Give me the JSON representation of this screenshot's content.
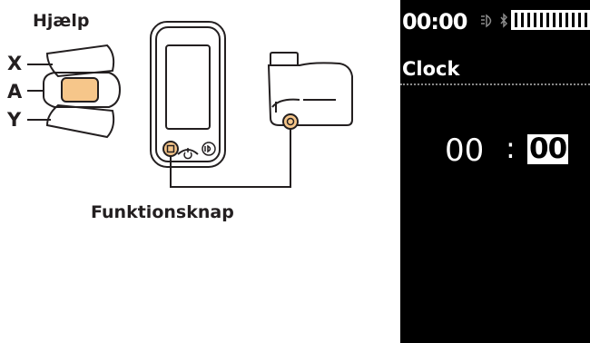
{
  "labels": {
    "help": "Hjælp",
    "x": "X",
    "a": "A",
    "y": "Y",
    "function_button": "Funktionsknap"
  },
  "display": {
    "status_time": "00:00",
    "screen_title": "Clock",
    "hours": "00",
    "separator": ":",
    "minutes": "00",
    "icons": [
      "light-icon",
      "bluetooth-icon",
      "battery-icon"
    ]
  },
  "colors": {
    "highlight_button": "#f6c68a",
    "outline": "#231f20",
    "display_bg": "#000000"
  }
}
